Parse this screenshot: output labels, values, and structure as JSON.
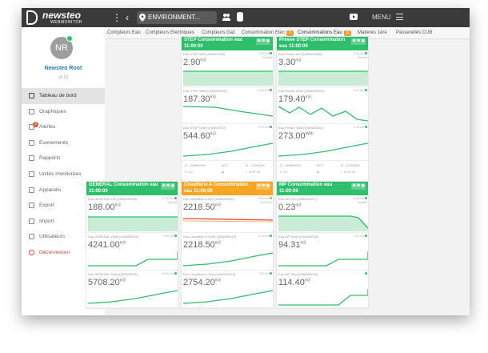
{
  "app": {
    "brand": "newsteo",
    "brand_sub": "WEBMONITOR",
    "environment": "ENVIRONMENT...",
    "menu_label": "MENU"
  },
  "user": {
    "initials": "NR",
    "name": "Newsteo Root",
    "version": "v1.13"
  },
  "nav": [
    {
      "label": "Tableau de bord",
      "icon": "monitor-icon",
      "active": true
    },
    {
      "label": "Graphiques",
      "icon": "chart-icon"
    },
    {
      "label": "Alertes",
      "icon": "bell-icon",
      "badge": "2"
    },
    {
      "label": "Evenements",
      "icon": "calendar-icon"
    },
    {
      "label": "Rapports",
      "icon": "report-icon"
    },
    {
      "label": "Unités monitorées",
      "icon": "target-icon"
    },
    {
      "label": "Appareils",
      "icon": "devices-icon"
    },
    {
      "label": "Export",
      "icon": "export-icon"
    },
    {
      "label": "Import",
      "icon": "import-icon"
    },
    {
      "label": "Utilisateurs",
      "icon": "users-icon"
    },
    {
      "label": "Déconnexion",
      "icon": "power-icon",
      "logout": true
    }
  ],
  "tabs": [
    {
      "label": "Compteurs Eau"
    },
    {
      "label": "Compteurs Electriques"
    },
    {
      "label": "Compteurs Gaz"
    },
    {
      "label": "Consommation Elec",
      "badge": "2"
    },
    {
      "label": "Consommations Eau",
      "badge": "3",
      "active": true
    },
    {
      "label": "Matières 1ère"
    },
    {
      "label": "Passerelles CUB"
    }
  ],
  "colors": {
    "green": "#2dbf6b",
    "orange": "#f5a623",
    "red": "#e04848"
  },
  "cards": [
    {
      "title": "STEP Consommation eau 11:00:00",
      "header_color": "#2dbf6b",
      "icons": "⊞ ✉ ◉",
      "sections": [
        {
          "label": "Eau STEP 24H [UNN000029]",
          "value": "2.90",
          "unit": "m3",
          "meta1": "0.90 m3",
          "meta2": "Normal",
          "chart": "flat-fill"
        },
        {
          "label": "Eau STEP Veille [UNN000028]",
          "value": "187.30",
          "unit": "m3",
          "meta1": "-0.50 m3",
          "meta2": "",
          "chart": "down"
        },
        {
          "label": "Eau STEP Total [UNN000027]",
          "value": "544.60",
          "unit": "m3",
          "meta1": "4.10 m3",
          "meta2": "",
          "chart": "up"
        }
      ],
      "footer": {
        "left1": "ZI - UNN000029",
        "mid1": "80°C",
        "right1": "ZI - CU000029",
        "left2": "≡ -1.C",
        "mid2": "◉",
        "right2": "✓ 12:07:39"
      }
    },
    {
      "title": "Presse STEP Consommation eau 11:00:00",
      "header_color": "#2dbf6b",
      "icons": "⊞ ✉ ◉",
      "sections": [
        {
          "label": "Eau Presse 24H [UNN000026]",
          "value": "3.30",
          "unit": "m3",
          "meta1": "0.30 m3",
          "meta2": "Normal",
          "chart": "flat-fill"
        },
        {
          "label": "Eau Presse Veille [UNN000025]",
          "value": "179.40",
          "unit": "m3",
          "meta1": "-1.20 m3",
          "meta2": "",
          "chart": "wave"
        },
        {
          "label": "Eau Presse Total [UNN000024]",
          "value": "273.00",
          "unit": "kWh",
          "meta1": "1.20 m3",
          "meta2": "",
          "chart": "up"
        }
      ],
      "footer": {
        "left1": "ZI - UNN000024",
        "mid1": "80°C",
        "right1": "ZI - CU000024",
        "left2": "≡ -1.C",
        "mid2": "◉",
        "right2": "✓ 12:07:39"
      }
    },
    {
      "title": "GENERAL Consommation eau 11:00:00",
      "header_color": "#2dbf6b",
      "icons": "⊞ ✉ ◉",
      "sections": [
        {
          "label": "Eau GENERAL 24H [UNN000023]",
          "value": "188.00",
          "unit": "m3",
          "meta1": "17.00 m3",
          "meta2": "Normal",
          "chart": "flat-fill"
        },
        {
          "label": "Eau GENERAL Veille [UNN000022]",
          "value": "4241.00",
          "unit": "m3",
          "meta1": "7.00 m3",
          "meta2": "",
          "chart": "step-up"
        },
        {
          "label": "Eau GENERAL Total [UNN000021]",
          "value": "5708.20",
          "unit": "m3",
          "meta1": "19.30 m3",
          "meta2": "",
          "chart": "up"
        }
      ]
    },
    {
      "title": "Chaufferie A Consommation eau 11:00:00",
      "header_color": "#f5a623",
      "icons": "⊞ ✉ ◉",
      "sections": [
        {
          "label": "Eau Chaufferie A 24H [UNN000020]",
          "value": "2218.50",
          "unit": "m3",
          "meta1": "-9.60 m3",
          "meta2": "10.70 m3",
          "chart": "red-flat",
          "warn": true
        },
        {
          "label": "Eau Chaufferie A Veille [UNN000019]",
          "value": "2218.50",
          "unit": "m3",
          "meta1": "4.10 m3",
          "meta2": "",
          "chart": "up"
        },
        {
          "label": "Eau Chaufferie A Total [UNN000018]",
          "value": "2754.20",
          "unit": "m3",
          "meta1": "7.50 m3",
          "meta2": "",
          "chart": "up"
        }
      ]
    },
    {
      "title": "MP Consommation eau 11:00:00",
      "header_color": "#2dbf6b",
      "icons": "⊞ ✉ ◉",
      "sections": [
        {
          "label": "Eau MP 24H [UNN000017]",
          "value": "0.23",
          "unit": "m3",
          "meta1": "-0.06 m3",
          "meta2": "Normal",
          "chart": "drop-fill"
        },
        {
          "label": "Eau MP Veille [UNN000016]",
          "value": "94.31",
          "unit": "m3",
          "meta1": "7.00 m3",
          "meta2": "",
          "chart": "step-up"
        },
        {
          "label": "Eau MP Total [UNN000015]",
          "value": "114.40",
          "unit": "m3",
          "meta1": "",
          "meta2": "",
          "chart": "step-up2"
        }
      ]
    }
  ]
}
